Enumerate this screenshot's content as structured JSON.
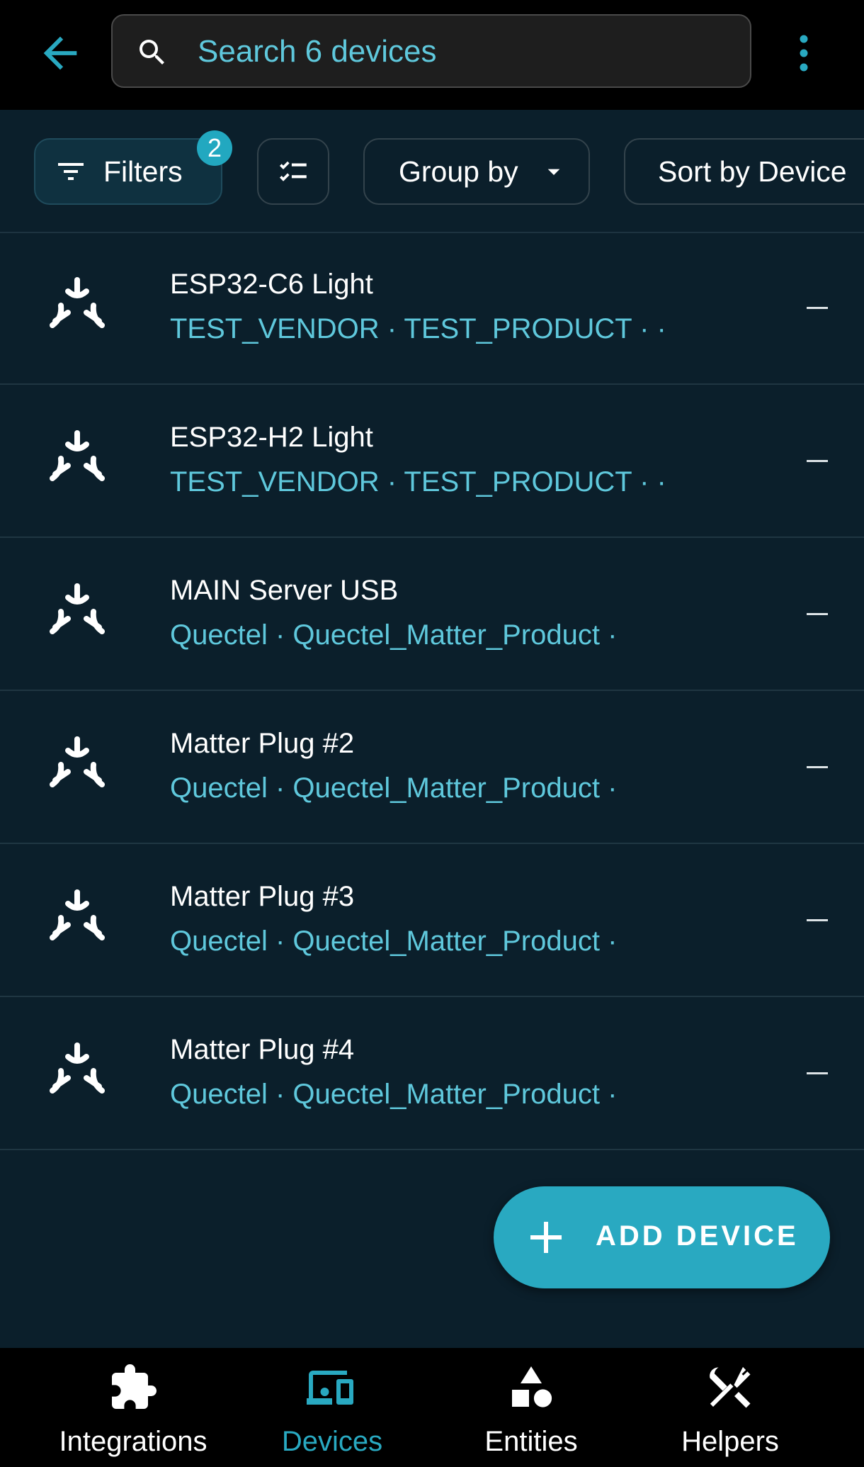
{
  "search": {
    "placeholder": "Search 6 devices"
  },
  "filters": {
    "label": "Filters",
    "badge_count": "2"
  },
  "group_by": {
    "label": "Group by"
  },
  "sort_by": {
    "label": "Sort by Device"
  },
  "devices": [
    {
      "name": "ESP32-C6 Light",
      "meta": "TEST_VENDOR · TEST_PRODUCT · ·",
      "area": "—"
    },
    {
      "name": "ESP32-H2 Light",
      "meta": "TEST_VENDOR · TEST_PRODUCT · ·",
      "area": "—"
    },
    {
      "name": "MAIN Server USB",
      "meta": "Quectel · Quectel_Matter_Product ·",
      "area": "—"
    },
    {
      "name": "Matter Plug #2",
      "meta": "Quectel · Quectel_Matter_Product ·",
      "area": "—"
    },
    {
      "name": "Matter Plug #3",
      "meta": "Quectel · Quectel_Matter_Product ·",
      "area": "—"
    },
    {
      "name": "Matter Plug #4",
      "meta": "Quectel · Quectel_Matter_Product ·",
      "area": "—"
    }
  ],
  "fab": {
    "label": "ADD DEVICE"
  },
  "nav": [
    {
      "label": "Integrations",
      "icon": "puzzle-icon"
    },
    {
      "label": "Devices",
      "icon": "devices-icon",
      "active": true
    },
    {
      "label": "Entities",
      "icon": "shapes-icon"
    },
    {
      "label": "Helpers",
      "icon": "tools-icon"
    }
  ],
  "colors": {
    "accent": "#29a9c1",
    "link": "#5fc8dc",
    "background": "#0b1f2b",
    "bar": "#000000"
  }
}
